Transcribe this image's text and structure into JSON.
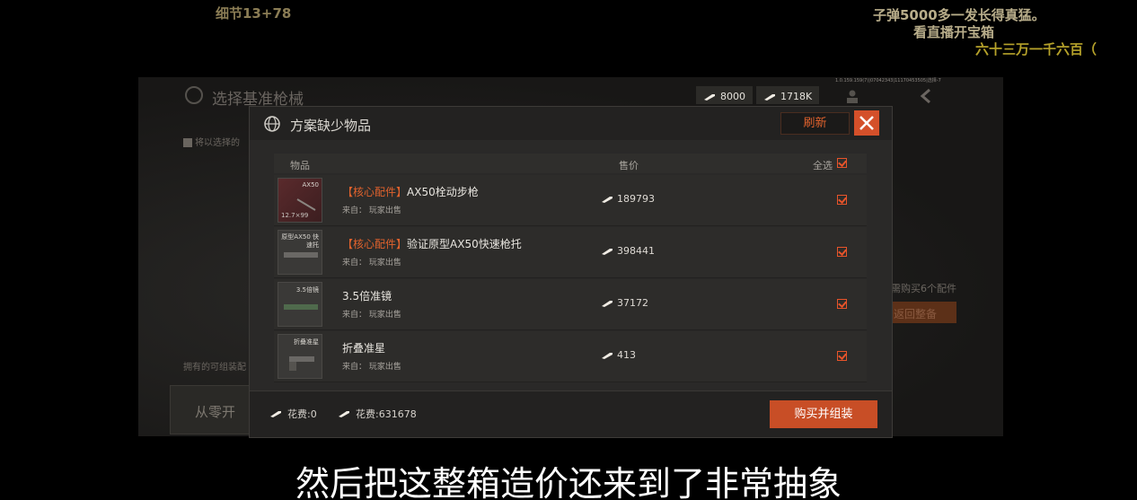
{
  "overlay": {
    "top_left": "细节13+78",
    "danmaku_1": "子弹5000多一发长得真猛。",
    "danmaku_2": "看直播开宝箱",
    "danmaku_3": "六十三万一千六百（"
  },
  "background": {
    "title": "选择基准枪械",
    "hint": "将以选择的",
    "owned": "拥有的可组装配",
    "scratch_button": "从零开",
    "buy6": "需购买6个配件",
    "confirm": "返回整备"
  },
  "currency": {
    "coin_a": "8000",
    "coin_b": "1718K",
    "build_info": "1.0.159.159(7)|07042343|11170453505|选择-7"
  },
  "modal": {
    "title": "方案缺少物品",
    "refresh_label": "刷新",
    "columns": {
      "item": "物品",
      "price": "售价",
      "select_all": "全选"
    },
    "items": [
      {
        "tag": "【核心配件】",
        "name": "AX50栓动步枪",
        "source": "来自： 玩家出售",
        "price": "189793",
        "thumb_label": "AX50",
        "thumb_sub": "12.7×99",
        "checked": true
      },
      {
        "tag": "【核心配件】",
        "name": "验证原型AX50快速枪托",
        "source": "来自： 玩家出售",
        "price": "398441",
        "thumb_label": "原型AX50 快速托",
        "thumb_sub": "",
        "checked": true
      },
      {
        "tag": "",
        "name": "3.5倍准镜",
        "source": "来自： 玩家出售",
        "price": "37172",
        "thumb_label": "3.5倍镜",
        "thumb_sub": "",
        "checked": true
      },
      {
        "tag": "",
        "name": "折叠准星",
        "source": "来自： 玩家出售",
        "price": "413",
        "thumb_label": "折叠准星",
        "thumb_sub": "",
        "checked": true
      }
    ],
    "footer": {
      "cost_a": "花费:0",
      "cost_b": "花费:631678",
      "buy_label": "购买并组装"
    }
  },
  "subtitle": "然后把这整箱造价还来到了非常抽象",
  "colors": {
    "accent": "#e0622d",
    "buy_button": "#c84e26",
    "close_button": "#d4502a"
  }
}
